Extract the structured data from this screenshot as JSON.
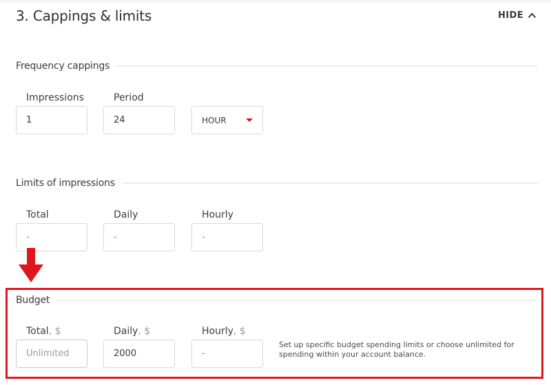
{
  "section": {
    "title": "3. Cappings & limits",
    "toggle_label": "HIDE",
    "toggle_icon": "chevron-up-icon"
  },
  "frequency_cappings": {
    "title": "Frequency cappings",
    "impressions": {
      "label": "Impressions",
      "value": "1"
    },
    "period": {
      "label": "Period",
      "value": "24"
    },
    "unit": {
      "selected": "HOUR",
      "icon": "dropdown-caret-icon"
    }
  },
  "limits_of_impressions": {
    "title": "Limits of impressions",
    "total": {
      "label": "Total",
      "value": "",
      "placeholder": "-"
    },
    "daily": {
      "label": "Daily",
      "value": "",
      "placeholder": "-"
    },
    "hourly": {
      "label": "Hourly",
      "value": "",
      "placeholder": "-"
    }
  },
  "budget": {
    "title": "Budget",
    "currency_suffix": ", $",
    "total": {
      "label": "Total",
      "value": "",
      "placeholder": "Unlimited"
    },
    "daily": {
      "label": "Daily",
      "value": "2000",
      "placeholder": ""
    },
    "hourly": {
      "label": "Hourly",
      "value": "",
      "placeholder": "-"
    },
    "help_text": "Set up specific budget spending limits or choose unlimited for spending within your account balance."
  },
  "annotation": {
    "arrow_icon": "arrow-down-icon",
    "highlight_color": "#e0161f"
  },
  "colors": {
    "accent": "#d0141b",
    "text": "#3a3a3a",
    "border": "#d9d9d9"
  }
}
